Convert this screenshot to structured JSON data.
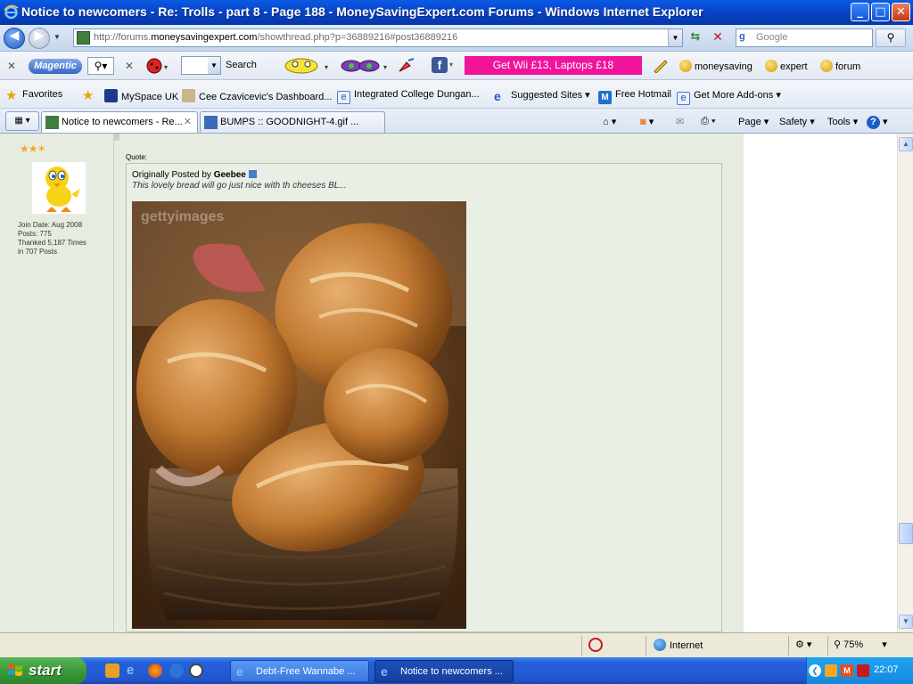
{
  "window": {
    "title": "Notice to newcomers - Re: Trolls - part 8 - Page 188 - MoneySavingExpert.com Forums - Windows Internet Explorer",
    "minimize": "_",
    "maximize": "□",
    "close": "✕"
  },
  "addressbar": {
    "url_prefix": "http://forums.",
    "url_domain": "moneysavingexpert.com",
    "url_path": "/showthread.php?p=36889216#post36889216",
    "search_placeholder": "Google"
  },
  "magentic": {
    "logo": "Magentic",
    "search_label": "Search",
    "promo": "Get Wii £13, Laptops £18",
    "links": [
      "moneysaving",
      "expert",
      "forum"
    ]
  },
  "favorites": {
    "label": "Favorites",
    "items": [
      "MySpace UK",
      "Cee Czavicevic's Dashboard...",
      "Integrated College Dungan...",
      "Suggested Sites",
      "Free Hotmail",
      "Get More Add-ons"
    ]
  },
  "tabs": [
    {
      "label": "Notice to newcomers - Re...",
      "active": true
    },
    {
      "label": "BUMPS :: GOODNIGHT-4.gif ...",
      "active": false
    }
  ],
  "commands": {
    "page": "Page",
    "safety": "Safety",
    "tools": "Tools"
  },
  "post": {
    "join_date": "Join Date:  Aug 2008",
    "posts": "Posts:  775",
    "thanked": "Thanked 5,187 Times",
    "in_posts": "in 707 Posts",
    "quote_label": "Quote:",
    "originally_posted_by": "Originally Posted by",
    "quote_author": "Geebee",
    "quote_text": "This lovely bread will go just nice with th cheeses BL...",
    "watermark": "gettyimages"
  },
  "status": {
    "zone": "Internet",
    "zoom": "75%"
  },
  "taskbar": {
    "start": "start",
    "tasks": [
      "Debt-Free Wannabe ...",
      "Notice to newcomers ..."
    ],
    "clock": "22:07"
  },
  "colors": {
    "promo": "#F0149A",
    "titlebar": "#0842C4",
    "post_bg": "#E6EDE0",
    "start_green": "#3A9A3A"
  }
}
